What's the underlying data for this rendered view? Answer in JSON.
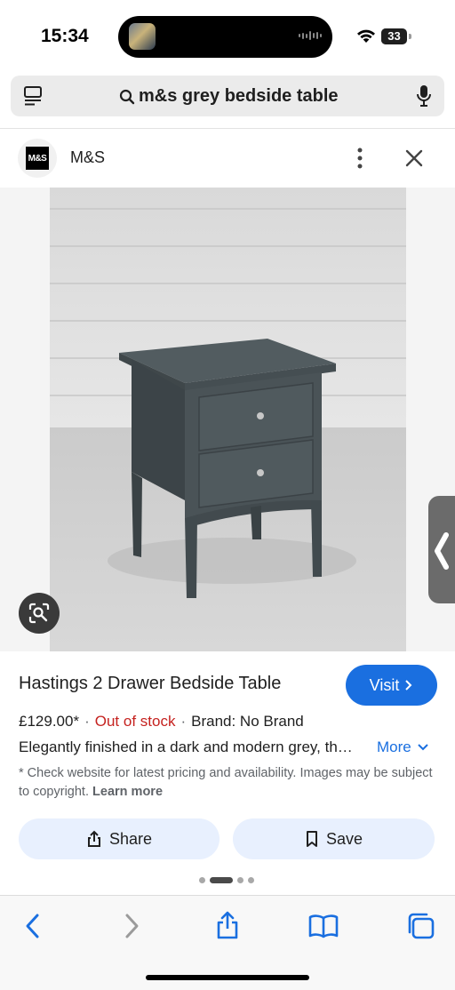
{
  "status_bar": {
    "time": "15:34",
    "battery": "33",
    "battery_level": 0.33,
    "icons": [
      "wifi-icon",
      "battery-icon"
    ]
  },
  "search": {
    "query": "m&s grey bedside table",
    "icons": [
      "tabs-icon",
      "search-icon",
      "mic-icon"
    ]
  },
  "source": {
    "logo_text": "M&S",
    "name": "M&S"
  },
  "product": {
    "title": "Hastings 2 Drawer Bedside Table",
    "visit_label": "Visit",
    "price": "£129.00*",
    "stock": "Out of stock",
    "brand": "Brand: No Brand",
    "description": "Elegantly finished in a dark and modern grey, th…",
    "more_label": "More",
    "disclaimer": "* Check website for latest pricing and availability. Images may be subject to copyright.",
    "learn_more": "Learn more"
  },
  "actions": {
    "share_label": "Share",
    "save_label": "Save"
  },
  "pager": {
    "count": 4,
    "active_index": 1
  },
  "colors": {
    "accent": "#1a6fe0",
    "out_of_stock": "#c5221f",
    "action_button_bg": "#e8f0fe",
    "product_grey": "#4a5357"
  },
  "toolbar": {
    "icons": [
      "back-icon",
      "forward-icon",
      "share-icon",
      "bookmarks-icon",
      "tabs-icon"
    ]
  }
}
